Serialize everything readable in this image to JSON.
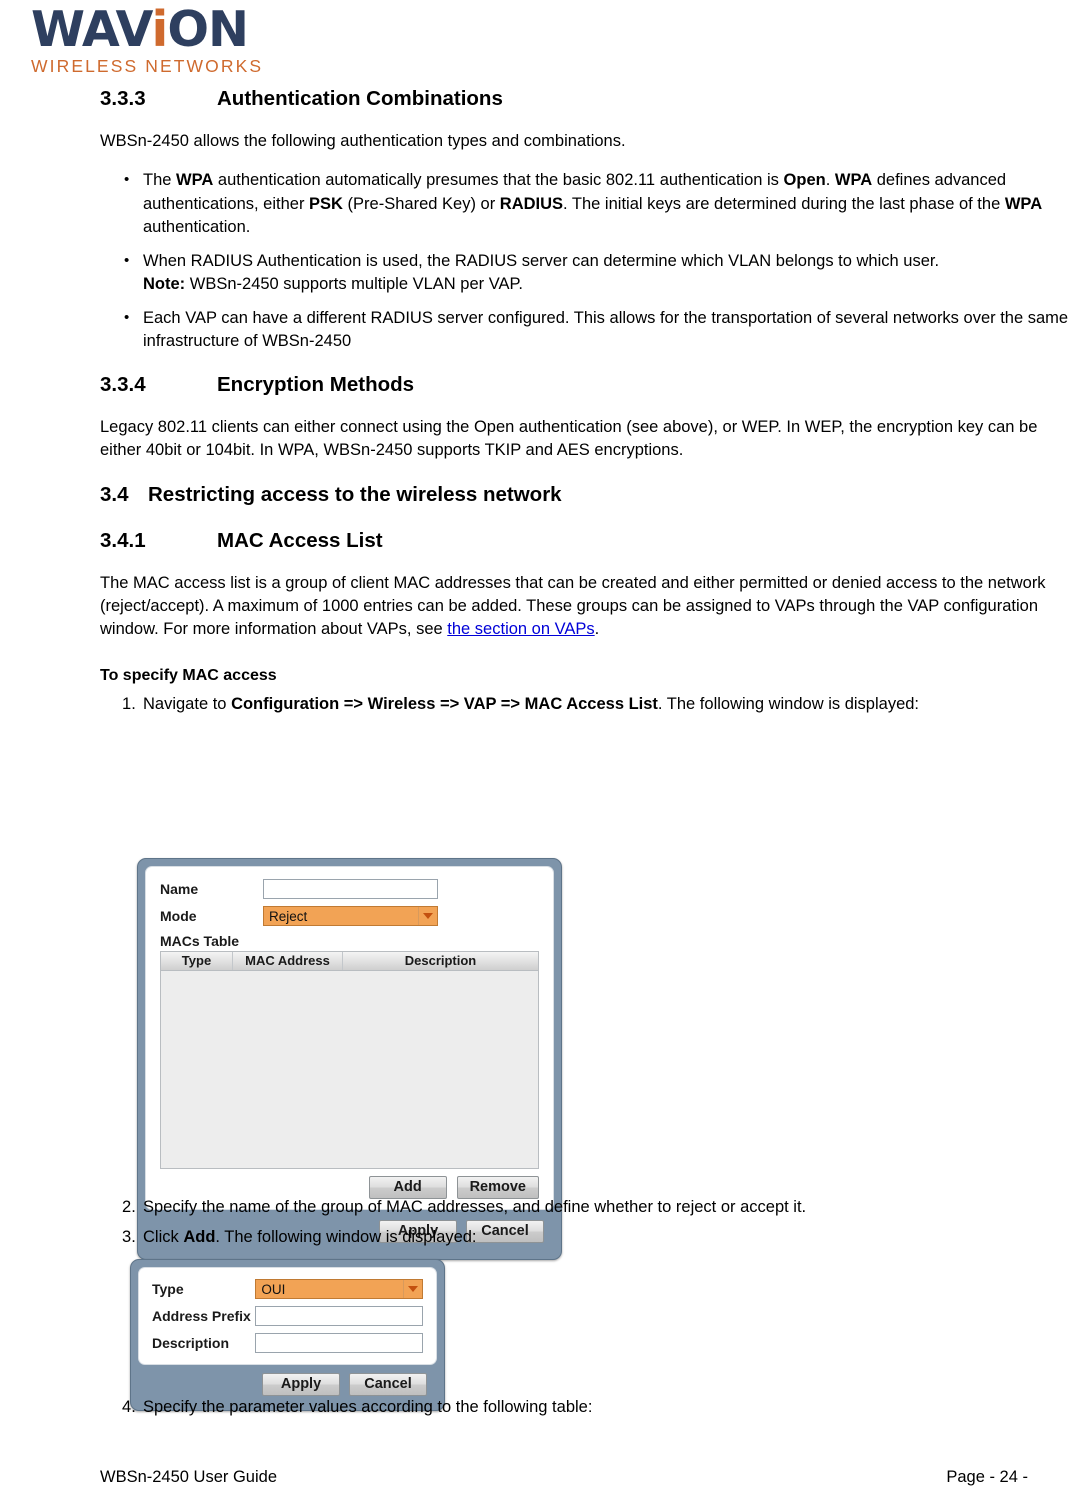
{
  "logo": {
    "word_part1": "WAV",
    "word_i": "i",
    "word_part2": "ON",
    "tagline": "WIRELESS NETWORKS"
  },
  "sections": {
    "s333": {
      "number": "3.3.3",
      "title": "Authentication Combinations",
      "intro": "WBSn-2450 allows the following authentication types and combinations.",
      "bullets": [
        "The WPA authentication automatically presumes that the basic 802.11 authentication is Open. WPA defines advanced authentications, either PSK (Pre-Shared Key) or RADIUS. The initial keys are determined during the last phase of the WPA authentication.",
        "When RADIUS Authentication is used, the RADIUS server can determine which VLAN belongs to which user. Note: WBSn-2450 supports multiple VLAN per VAP.",
        "Each VAP can have a different RADIUS server configured. This allows for the transportation of several networks over the same infrastructure of WBSn-2450"
      ]
    },
    "s334": {
      "number": "3.3.4",
      "title": "Encryption Methods",
      "body": "Legacy 802.11 clients can either connect using the Open authentication (see above), or WEP. In WEP, the encryption key can be either 40bit or 104bit. In WPA, WBSn-2450 supports TKIP and AES encryptions."
    },
    "s34": {
      "number": "3.4",
      "title": "Restricting access to the wireless network"
    },
    "s341": {
      "number": "3.4.1",
      "title": "MAC Access List",
      "body_part1": "The MAC access list is a group of client MAC addresses that can be created and either permitted or denied access to the network (reject/accept). A maximum of 1000 entries can be added. These groups can be assigned to VAPs through the VAP configuration window. For more information about VAPs, see ",
      "link_text": "the section on VAPs",
      "body_part2": "."
    }
  },
  "procedure": {
    "heading": "To specify MAC access",
    "step1_a": "Navigate to ",
    "step1_bold": "Configuration => Wireless => VAP => MAC Access List",
    "step1_b": ". The following window is displayed:",
    "step2": "Specify the name of the group of MAC addresses, and define whether to reject or accept it.",
    "step3_a": "Click ",
    "step3_bold": "Add",
    "step3_b": ". The following window is displayed:",
    "step4": "Specify the parameter values according to the following table:"
  },
  "dialog_mac_access_list": {
    "name_label": "Name",
    "name_value": "",
    "mode_label": "Mode",
    "mode_value": "Reject",
    "table_title": "MACs Table",
    "columns": [
      "Type",
      "MAC Address",
      "Description"
    ],
    "rows": [],
    "add_label": "Add",
    "remove_label": "Remove",
    "apply_label": "Apply",
    "cancel_label": "Cancel"
  },
  "dialog_add_mac": {
    "type_label": "Type",
    "type_value": "OUI",
    "address_prefix_label": "Address Prefix",
    "address_prefix_value": "",
    "description_label": "Description",
    "description_value": "",
    "apply_label": "Apply",
    "cancel_label": "Cancel"
  },
  "footer": {
    "left": "WBSn-2450 User Guide",
    "right": "Page - 24 -"
  },
  "colors": {
    "logo_navy": "#2e3f5f",
    "logo_orange": "#cf6a2e",
    "dialog_frame": "#7e94aa",
    "dropdown_orange": "#f2a355",
    "link_blue": "#0000d8"
  }
}
